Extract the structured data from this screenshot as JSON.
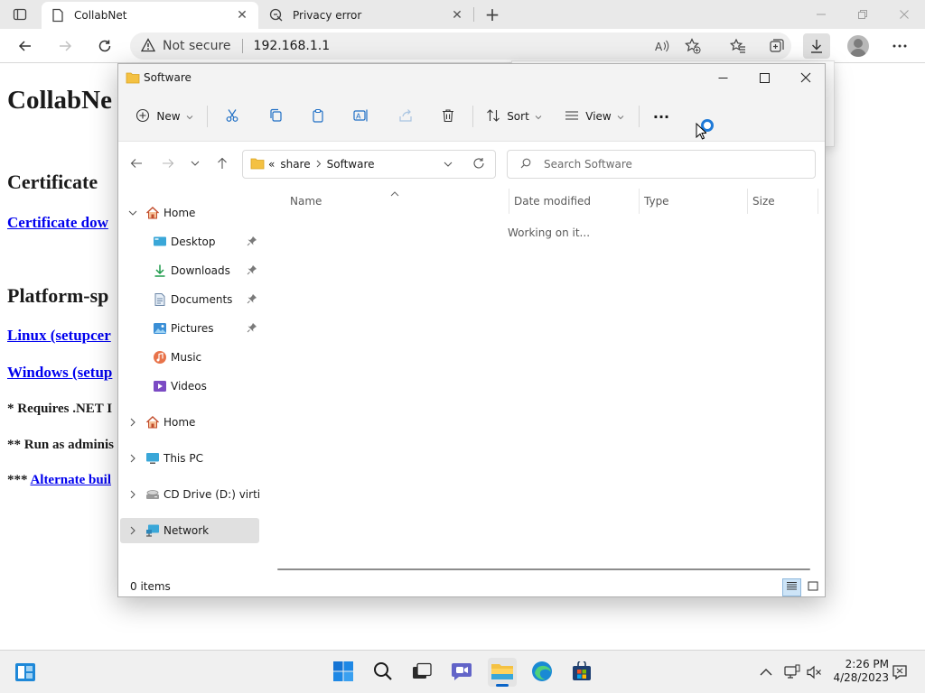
{
  "browser": {
    "tabs": [
      {
        "title": "CollabNet",
        "active": true
      },
      {
        "title": "Privacy error",
        "active": false
      }
    ],
    "address": {
      "security_label": "Not secure",
      "url": "192.168.1.1"
    }
  },
  "webpage": {
    "title": "CollabNe",
    "certificate_heading": "Certificate",
    "certificate_link": "Certificate dow",
    "platform_heading": "Platform-sp",
    "linux_link": "Linux (setupcer",
    "windows_link": "Windows (setup",
    "note1": "* Requires .NET I",
    "note2": "** Run as adminis",
    "note3_prefix": "*** ",
    "note3_link": "Alternate buil"
  },
  "explorer": {
    "window_title": "Software",
    "commands": {
      "new": "New",
      "sort": "Sort",
      "view": "View",
      "more": "···"
    },
    "path": {
      "overflow": "«",
      "segments": [
        "share",
        "Software"
      ]
    },
    "search_placeholder": "Search Software",
    "nav": [
      {
        "label": "Home",
        "icon": "home-icon",
        "expanded": true
      },
      {
        "label": "Desktop",
        "icon": "desktop-icon",
        "pinned": true
      },
      {
        "label": "Downloads",
        "icon": "download-icon",
        "pinned": true
      },
      {
        "label": "Documents",
        "icon": "documents-icon",
        "pinned": true
      },
      {
        "label": "Pictures",
        "icon": "pictures-icon",
        "pinned": true
      },
      {
        "label": "Music",
        "icon": "music-icon"
      },
      {
        "label": "Videos",
        "icon": "videos-icon"
      },
      {
        "label": "Home",
        "icon": "home-icon",
        "expanded": false
      },
      {
        "label": "This PC",
        "icon": "pc-icon",
        "expanded": false
      },
      {
        "label": "CD Drive (D:) virtio-v",
        "icon": "cd-drive-icon",
        "expanded": false
      },
      {
        "label": "Network",
        "icon": "network-icon",
        "expanded": false,
        "selected": true
      }
    ],
    "columns": [
      "Name",
      "Date modified",
      "Type",
      "Size"
    ],
    "status_message": "Working on it...",
    "item_count": "0 items"
  },
  "taskbar": {
    "apps": [
      "start-icon",
      "search-icon",
      "task-view-icon",
      "chat-icon",
      "file-explorer-icon",
      "edge-icon",
      "store-icon"
    ],
    "time": "2:26 PM",
    "date": "4/28/2023"
  },
  "colors": {
    "accent": "#0a64c8",
    "link": "#0000ee",
    "folder": "#f4c142"
  }
}
